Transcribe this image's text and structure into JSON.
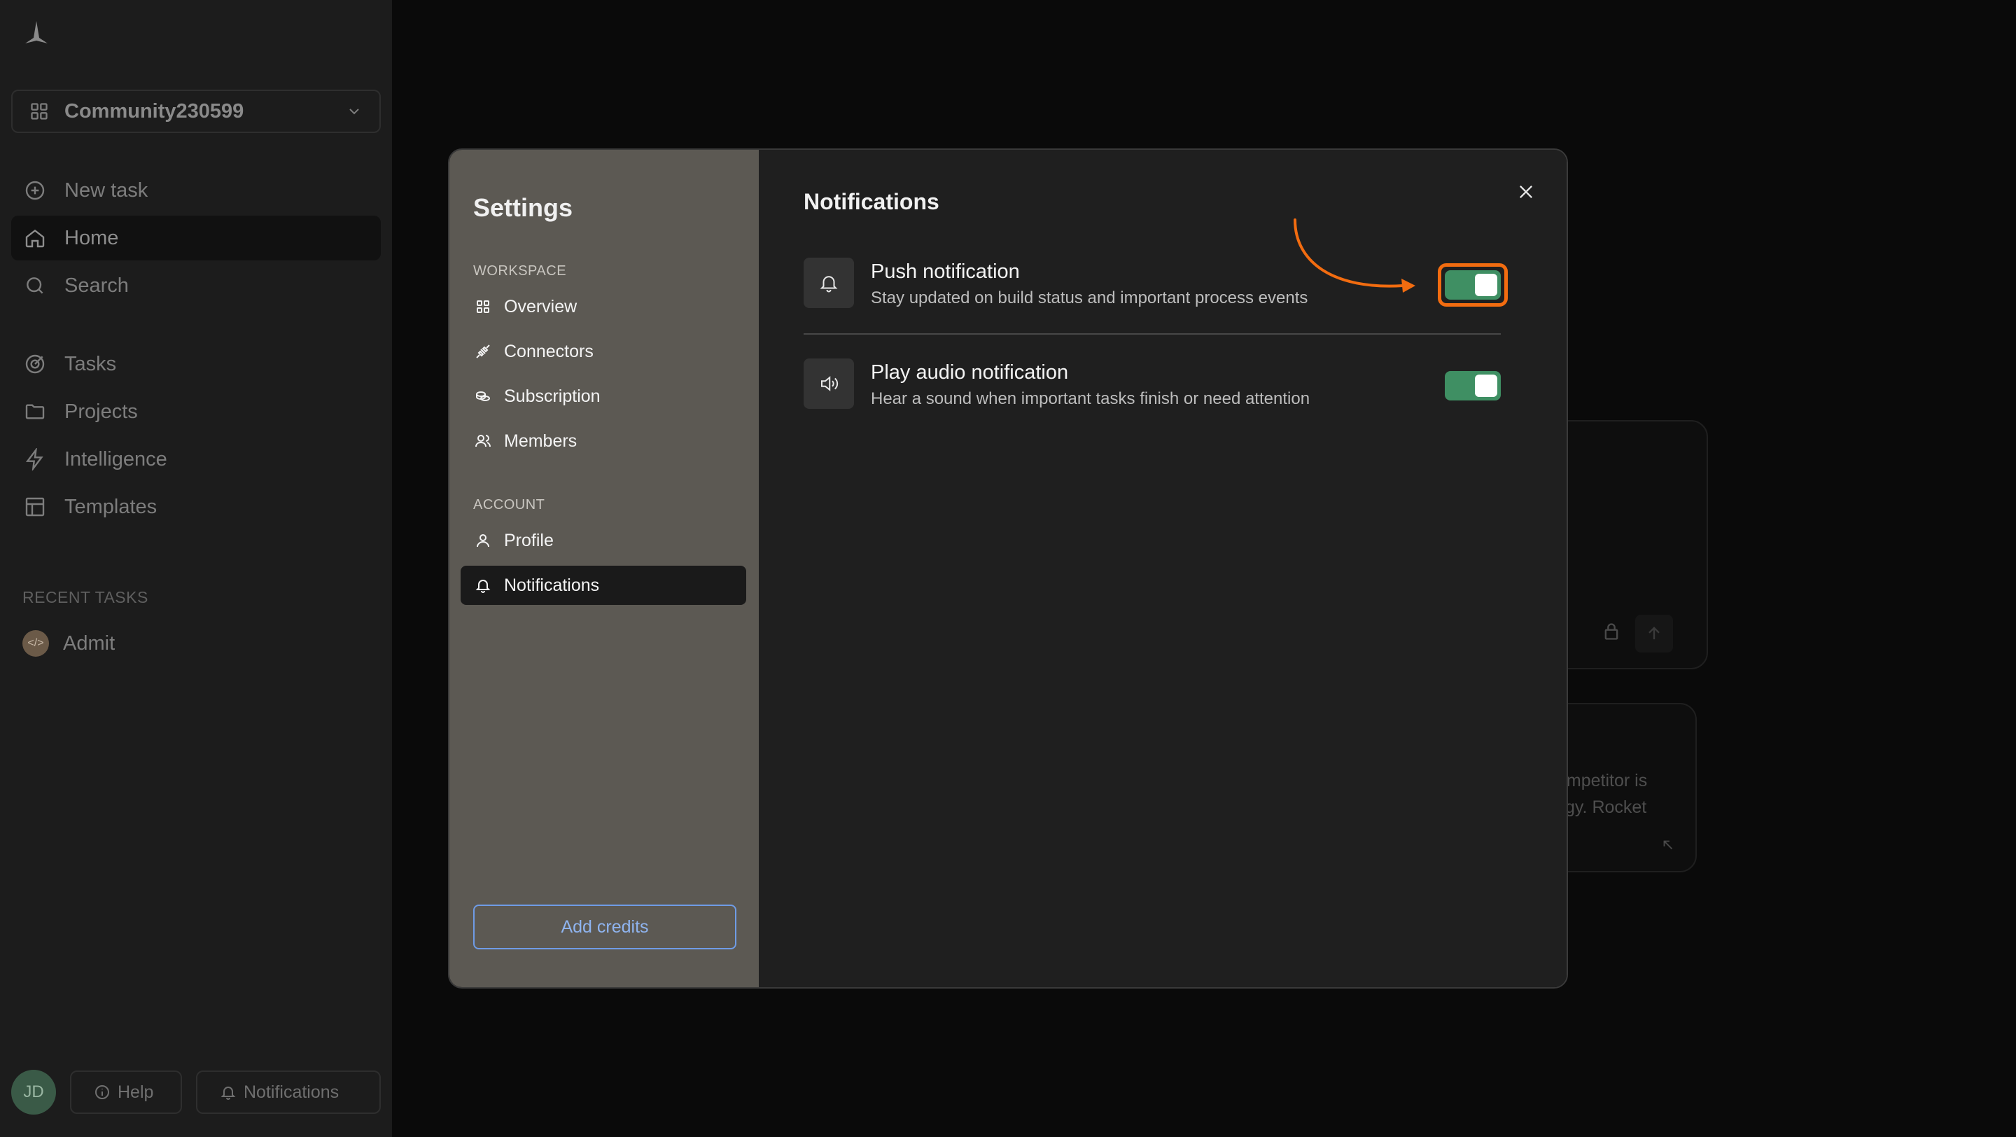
{
  "sidebar": {
    "workspace": "Community230599",
    "nav": [
      {
        "label": "New task",
        "icon": "plus-circle-icon"
      },
      {
        "label": "Home",
        "icon": "home-icon"
      },
      {
        "label": "Search",
        "icon": "search-icon"
      },
      {
        "label": "Tasks",
        "icon": "target-icon"
      },
      {
        "label": "Projects",
        "icon": "folder-icon"
      },
      {
        "label": "Intelligence",
        "icon": "bolt-icon"
      },
      {
        "label": "Templates",
        "icon": "layout-icon"
      }
    ],
    "recent_label": "RECENT TASKS",
    "recent_items": [
      {
        "label": "Admit",
        "icon": "code-icon"
      }
    ],
    "avatar_initials": "JD",
    "help_label": "Help",
    "notifications_label": "Notifications"
  },
  "background": {
    "card_text_line1": "ompetitor is",
    "card_text_line2": "gy. Rocket"
  },
  "modal": {
    "title": "Settings",
    "workspace_section": "WORKSPACE",
    "workspace_items": [
      {
        "label": "Overview",
        "icon": "grid-icon"
      },
      {
        "label": "Connectors",
        "icon": "plug-icon"
      },
      {
        "label": "Subscription",
        "icon": "coins-icon"
      },
      {
        "label": "Members",
        "icon": "users-icon"
      }
    ],
    "account_section": "ACCOUNT",
    "account_items": [
      {
        "label": "Profile",
        "icon": "user-icon"
      },
      {
        "label": "Notifications",
        "icon": "bell-icon"
      }
    ],
    "add_credits": "Add credits",
    "content_title": "Notifications",
    "settings": [
      {
        "title": "Push notification",
        "description": "Stay updated on build status and important process events",
        "enabled": true,
        "icon": "bell-icon"
      },
      {
        "title": "Play audio notification",
        "description": "Hear a sound when important tasks finish or need attention",
        "enabled": true,
        "icon": "speaker-icon"
      }
    ]
  },
  "colors": {
    "toggle_on": "#3f8f63",
    "highlight": "#f26c10",
    "accent_link": "#8fb4ef"
  }
}
